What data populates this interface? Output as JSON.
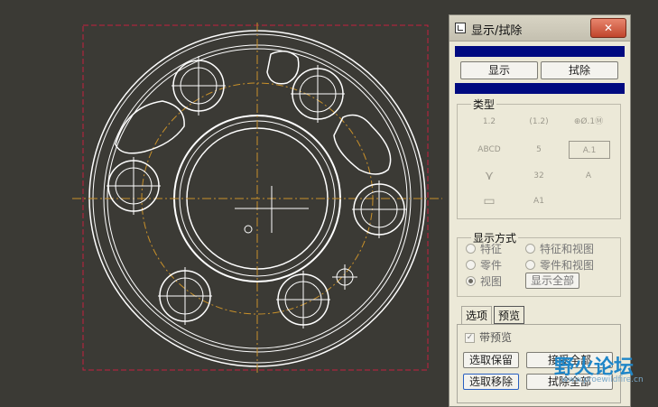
{
  "dialog": {
    "title": "显示/拭除",
    "close": "✕",
    "mode_buttons": {
      "show": "显示",
      "erase": "拭除"
    },
    "type_section": {
      "title": "类型",
      "symbols": [
        "1.2",
        "(1.2)",
        "⊕Ø.1Ⓜ",
        "ABCD",
        "5",
        "A.1",
        "32",
        "A",
        "A1"
      ]
    },
    "display_mode": {
      "title": "显示方式",
      "options": [
        {
          "label": "特征",
          "selected": false
        },
        {
          "label": "特征和视图",
          "selected": false
        },
        {
          "label": "零件",
          "selected": false
        },
        {
          "label": "零件和视图",
          "selected": false
        },
        {
          "label": "视图",
          "selected": true
        }
      ],
      "show_all": "显示全部"
    },
    "tabs": {
      "options": "选项",
      "preview": "预览",
      "active": "preview"
    },
    "preview_panel": {
      "with_preview": "带预览",
      "with_preview_checked": true,
      "select_keep": "选取保留",
      "accept_all": "接受全部",
      "select_remove": "选取移除",
      "erase_all": "拭除全部"
    }
  },
  "watermark": {
    "name": "野火论坛",
    "url": "www.proewildfire.cn"
  },
  "colors": {
    "canvas_bg": "#3b3a35",
    "geometry": "#ffffff",
    "centerline": "#c8902a",
    "datum_frame": "#c42040",
    "title_blue": "#000a80"
  }
}
